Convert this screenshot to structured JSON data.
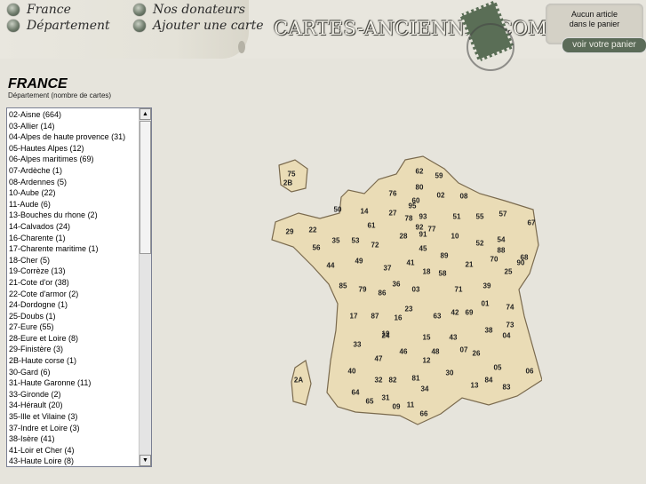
{
  "nav": [
    {
      "label": "France",
      "icon": "bullet-icon"
    },
    {
      "label": "Département",
      "icon": "bullet-icon"
    },
    {
      "label": "Nos donateurs",
      "icon": "bullet-icon"
    },
    {
      "label": "Ajouter une carte",
      "icon": "bullet-icon"
    }
  ],
  "logo": {
    "text": "CARTES-ANCIENNES.COM"
  },
  "cart": {
    "line1": "Aucun article",
    "line2": "dans le panier",
    "button": "voir votre panier"
  },
  "page": {
    "title": "FRANCE",
    "subtitle": "Département (nombre de cartes)"
  },
  "departments": [
    "02-Aisne (664)",
    "03-Allier (14)",
    "04-Alpes de haute provence (31)",
    "05-Hautes Alpes (12)",
    "06-Alpes maritimes (69)",
    "07-Ardèche (1)",
    "08-Ardennes (5)",
    "10-Aube (22)",
    "11-Aude (6)",
    "13-Bouches du rhone (2)",
    "14-Calvados (24)",
    "16-Charente (1)",
    "17-Charente maritime (1)",
    "18-Cher (5)",
    "19-Corrèze (13)",
    "21-Cote d'or (38)",
    "22-Cote d'armor (2)",
    "24-Dordogne (1)",
    "25-Doubs (1)",
    "27-Eure (55)",
    "28-Eure et Loire (8)",
    "29-Finistère (3)",
    "2B-Haute corse (1)",
    "30-Gard (6)",
    "31-Haute Garonne (11)",
    "33-Gironde (2)",
    "34-Hérault (20)",
    "35-Ille et Vilaine (3)",
    "37-Indre et Loire (3)",
    "38-Isère (41)",
    "41-Loir et Cher (4)",
    "43-Haute Loire (8)"
  ],
  "map_labels": [
    "62",
    "59",
    "80",
    "02",
    "08",
    "76",
    "60",
    "14",
    "27",
    "95",
    "78",
    "93",
    "92",
    "91",
    "50",
    "61",
    "28",
    "77",
    "51",
    "55",
    "57",
    "67",
    "54",
    "88",
    "68",
    "29",
    "22",
    "35",
    "53",
    "72",
    "45",
    "10",
    "52",
    "70",
    "90",
    "56",
    "44",
    "49",
    "37",
    "41",
    "89",
    "21",
    "25",
    "39",
    "86",
    "85",
    "36",
    "18",
    "58",
    "71",
    "01",
    "74",
    "79",
    "03",
    "23",
    "17",
    "87",
    "16",
    "19",
    "63",
    "42",
    "69",
    "38",
    "73",
    "24",
    "15",
    "43",
    "33",
    "47",
    "46",
    "48",
    "07",
    "26",
    "04",
    "05",
    "12",
    "82",
    "81",
    "30",
    "84",
    "06",
    "83",
    "13",
    "40",
    "32",
    "31",
    "34",
    "64",
    "65",
    "09",
    "11",
    "66",
    "75",
    "2B",
    "2A"
  ],
  "scrollbar": {
    "up": "▲",
    "down": "▼"
  }
}
